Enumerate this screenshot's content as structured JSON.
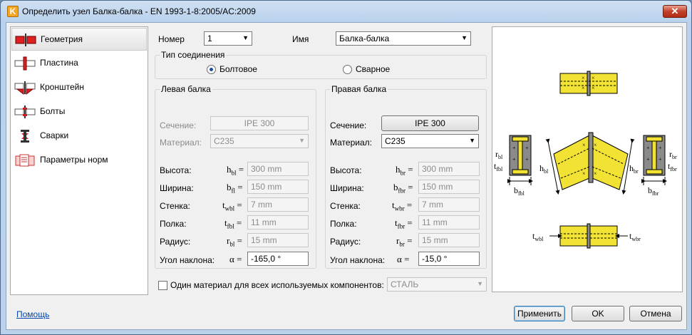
{
  "window": {
    "title": "Определить узел Балка-балка - EN 1993-1-8:2005/AC:2009",
    "app_icon_letter": "K",
    "close_glyph": "✕"
  },
  "sidebar": {
    "items": [
      {
        "label": "Геометрия",
        "icon": "geometry-icon",
        "active": true
      },
      {
        "label": "Пластина",
        "icon": "plate-icon"
      },
      {
        "label": "Кронштейн",
        "icon": "bracket-icon"
      },
      {
        "label": "Болты",
        "icon": "bolts-icon"
      },
      {
        "label": "Сварки",
        "icon": "welds-icon"
      },
      {
        "label": "Параметры норм",
        "icon": "code-params-icon"
      }
    ]
  },
  "form": {
    "number_label": "Номер",
    "number_value": "1",
    "name_label": "Имя",
    "name_value": "Балка-балка",
    "connection_type": {
      "title": "Тип соединения",
      "bolted": "Болтовое",
      "welded": "Сварное",
      "selected": "bolted"
    },
    "left_beam": {
      "title": "Левая балка",
      "section_label": "Сечение:",
      "section_value": "IPE 300",
      "material_label": "Материал:",
      "material_value": "C235",
      "height_label": "Высота:",
      "height_sym": "h",
      "height_sub": "bl",
      "height_value": "300 mm",
      "width_label": "Ширина:",
      "width_sym": "b",
      "width_sub": "fl",
      "width_value": "150 mm",
      "web_label": "Стенка:",
      "web_sym": "t",
      "web_sub": "wbl",
      "web_value": "7 mm",
      "flange_label": "Полка:",
      "flange_sym": "t",
      "flange_sub": "fbl",
      "flange_value": "11 mm",
      "radius_label": "Радиус:",
      "radius_sym": "r",
      "radius_sub": "bl",
      "radius_value": "15 mm",
      "angle_label": "Угол наклона:",
      "angle_sym": "α",
      "angle_value": "-165,0 °"
    },
    "right_beam": {
      "title": "Правая балка",
      "section_label": "Сечение:",
      "section_value": "IPE 300",
      "material_label": "Материал:",
      "material_value": "C235",
      "height_label": "Высота:",
      "height_sym": "h",
      "height_sub": "br",
      "height_value": "300 mm",
      "width_label": "Ширина:",
      "width_sym": "b",
      "width_sub": "fbr",
      "width_value": "150 mm",
      "web_label": "Стенка:",
      "web_sym": "t",
      "web_sub": "wbr",
      "web_value": "7 mm",
      "flange_label": "Полка:",
      "flange_sym": "t",
      "flange_sub": "fbr",
      "flange_value": "11 mm",
      "radius_label": "Радиус:",
      "radius_sym": "r",
      "radius_sub": "br",
      "radius_value": "15 mm",
      "angle_label": "Угол наклона:",
      "angle_sym": "α",
      "angle_value": "-15,0 °"
    },
    "eq": "=",
    "single_material_label": "Один материал для всех используемых компонентов:",
    "single_material_value": "СТАЛЬ"
  },
  "diagram": {
    "labels": {
      "rbl": "r",
      "rbl_sub": "bl",
      "tfbl": "t",
      "tfbl_sub": "fbl",
      "bfbl": "b",
      "bfbl_sub": "fbl",
      "hbl": "h",
      "hbl_sub": "bl",
      "hbr": "h",
      "hbr_sub": "br",
      "rbr": "r",
      "rbr_sub": "br",
      "tfbr": "t",
      "tfbr_sub": "fbr",
      "bfbr": "b",
      "bfbr_sub": "fbr",
      "twbl": "t",
      "twbl_sub": "wbl",
      "twbr": "t",
      "twbr_sub": "wbr"
    },
    "beam_color": "#f2e233",
    "plate_color": "#8a8a8a"
  },
  "footer": {
    "help_link": "Помощь",
    "apply": "Применить",
    "ok": "OK",
    "cancel": "Отмена"
  }
}
